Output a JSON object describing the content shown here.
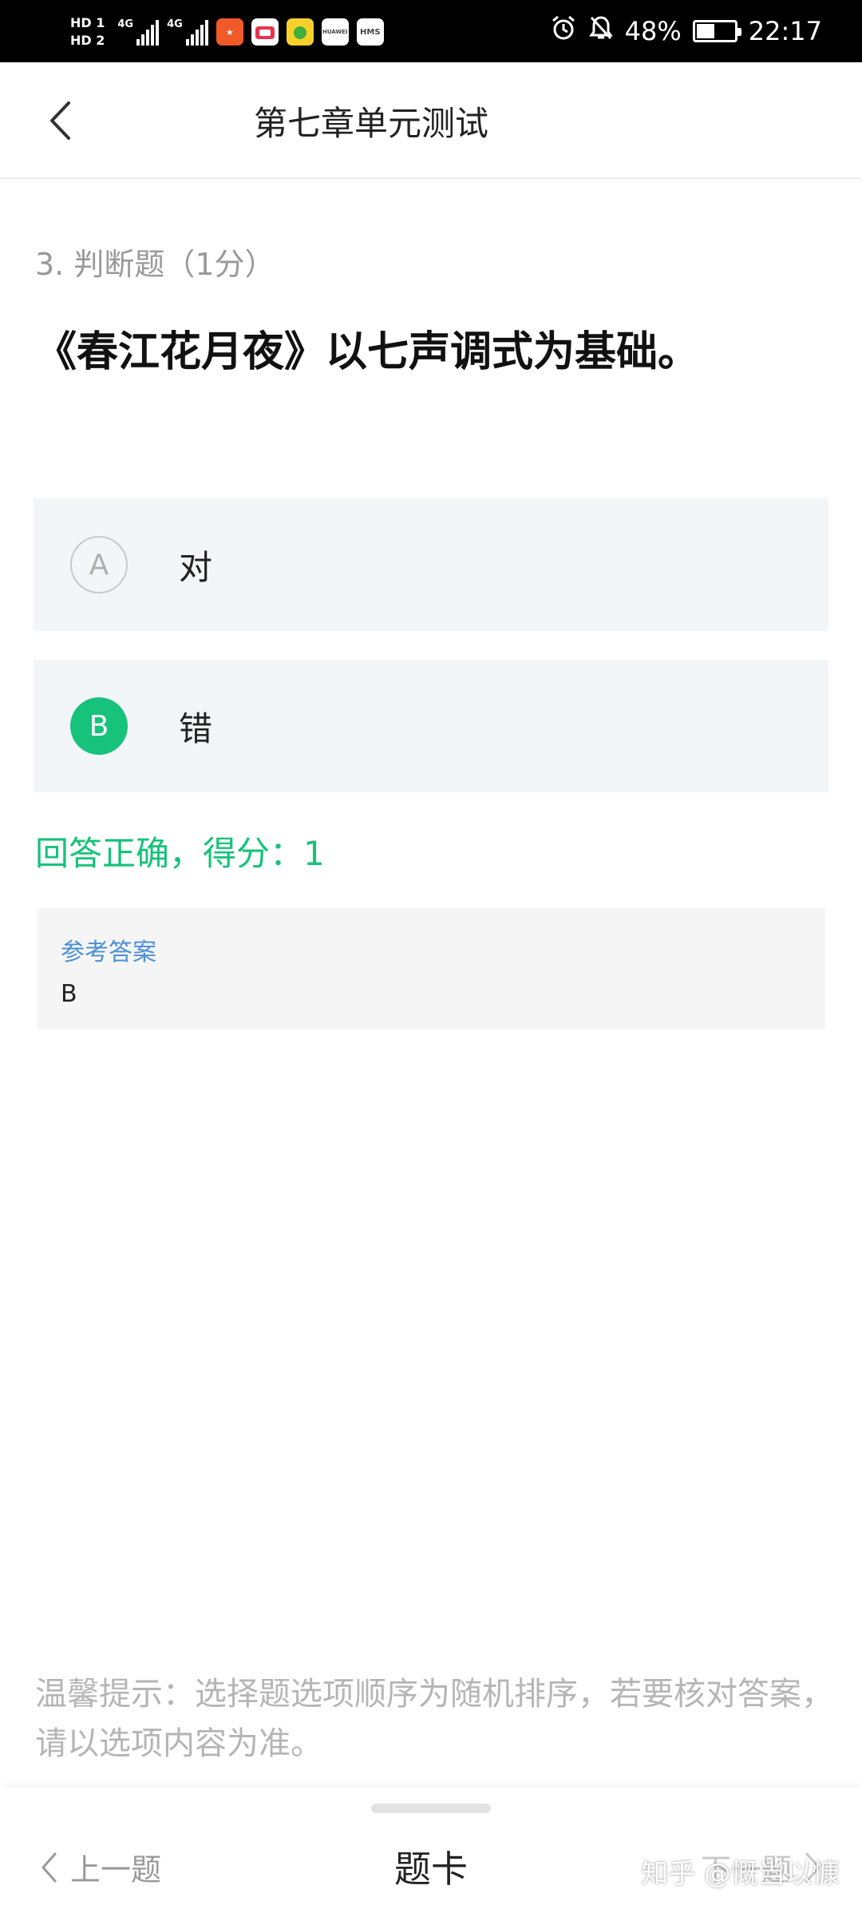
{
  "status_bar": {
    "hd1": "HD 1",
    "hd2": "HD 2",
    "signal1_label": "4G",
    "signal2_label": "4G",
    "app_icons": [
      "red-app-icon",
      "tv-app-icon",
      "green-app-icon",
      "huawei-app-icon",
      "hms-app-icon"
    ],
    "huawei_label": "HUAWEI",
    "hms_label": "HMS",
    "battery_percent": "48%",
    "battery_level": 0.48,
    "time": "22:17"
  },
  "nav": {
    "title": "第七章单元测试"
  },
  "question": {
    "meta": "3. 判断题（1分）",
    "text": "《春江花月夜》以七声调式为基础。"
  },
  "options": [
    {
      "letter": "A",
      "text": "对",
      "selected": false
    },
    {
      "letter": "B",
      "text": "错",
      "selected": true
    }
  ],
  "result": "回答正确，得分：1",
  "reference": {
    "label": "参考答案",
    "value": "B"
  },
  "tip": "温馨提示：选择题选项顺序为随机排序，若要核对答案，请以选项内容为准。",
  "bottom": {
    "prev": "上一题",
    "card": "题卡",
    "next": "下一题",
    "watermark": "知乎 @慨当以慷"
  },
  "colors": {
    "accent_green": "#17c27a",
    "link_blue": "#4a8fd6",
    "option_bg": "#f2f6f9"
  }
}
